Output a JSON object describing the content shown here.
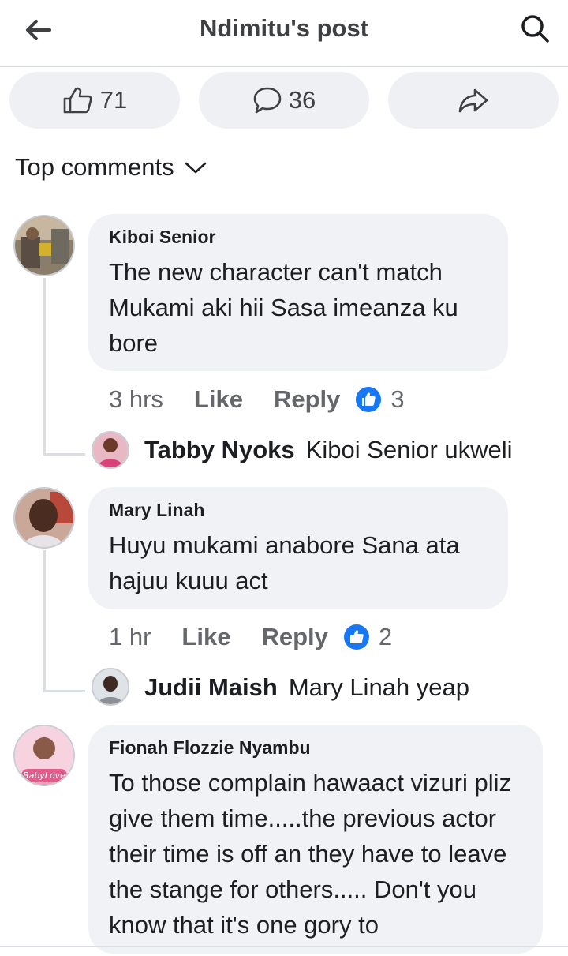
{
  "header": {
    "title": "Ndimitu's post",
    "back_icon": "arrow-left-icon",
    "search_icon": "search-icon"
  },
  "actions": {
    "likes": "71",
    "comments": "36",
    "share_icon": "share-icon"
  },
  "sort": {
    "label": "Top comments",
    "icon": "chevron-down-icon"
  },
  "comments": [
    {
      "author": "Kiboi Senior",
      "text": "The new character can't match Mukami aki hii Sasa imeanza ku bore",
      "time": "3 hrs",
      "like": "Like",
      "reply": "Reply",
      "reactions": "3",
      "replies": [
        {
          "author": "Tabby Nyoks",
          "text": "Kiboi Senior ukweli"
        }
      ]
    },
    {
      "author": "Mary Linah",
      "text": "Huyu mukami anabore Sana ata hajuu kuuu act",
      "time": "1 hr",
      "like": "Like",
      "reply": "Reply",
      "reactions": "2",
      "replies": [
        {
          "author": "Judii Maish",
          "text": "Mary Linah yeap"
        }
      ]
    },
    {
      "author": "Fionah Flozzie Nyambu",
      "text": "To those complain hawaact vizuri pliz give them time.....the previous actor their time is off an they have to leave the stange for others..... Don't you know that it's one gory to"
    }
  ],
  "avatar_labels": {
    "fionah": "BabyLove"
  },
  "colors": {
    "like_blue": "#1877f2",
    "bubble": "#f0f2f5",
    "muted": "#65676b"
  }
}
